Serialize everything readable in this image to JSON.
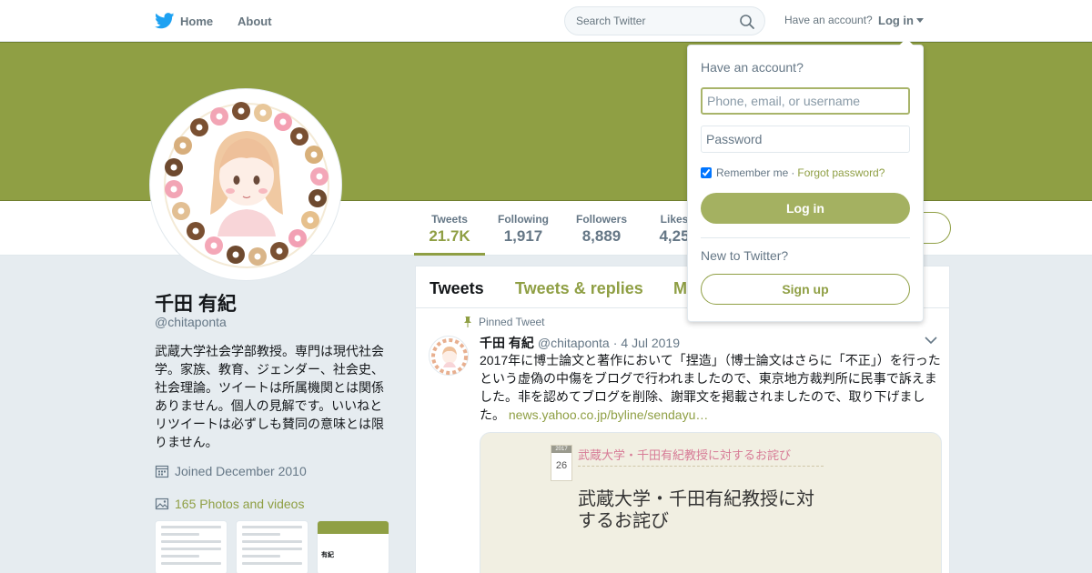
{
  "colors": {
    "accent": "#8f9f44",
    "twitter_blue": "#1da1f2",
    "text_muted": "#657786"
  },
  "nav": {
    "home_label": "Home",
    "about_label": "About",
    "search_placeholder": "Search Twitter",
    "have_account_text": "Have an account?",
    "login_label": "Log in"
  },
  "profile_nav": {
    "stats": [
      {
        "label": "Tweets",
        "value": "21.7K"
      },
      {
        "label": "Following",
        "value": "1,917"
      },
      {
        "label": "Followers",
        "value": "8,889"
      },
      {
        "label": "Likes",
        "value": "4,25"
      }
    ]
  },
  "profile": {
    "name": "千田 有紀",
    "handle": "@chitaponta",
    "bio": "武蔵大学社会学部教授。専門は現代社会学。家族、教育、ジェンダー、社会史、社会理論。ツイートは所属機関とは関係ありません。個人の見解です。いいねとリツイートは必ずしも賛同の意味とは限りません。",
    "joined": "Joined December 2010",
    "photos": "165 Photos and videos",
    "thumb_name": "有紀"
  },
  "timeline": {
    "tabs": [
      "Tweets",
      "Tweets & replies",
      "M"
    ],
    "pinned_label": "Pinned Tweet",
    "tweet": {
      "name": "千田 有紀",
      "handle": "@chitaponta",
      "date": "4 Jul 2019",
      "text": "2017年に博士論文と著作において「捏造」（博士論文はさらに「不正」）を行ったという虚偽の中傷をブログで行われましたので、東京地方裁判所に民事で訴えました。非を認めてブログを削除、謝罪文を掲載されましたので、取り下げました。",
      "link": "news.yahoo.co.jp/byline/sendayu…",
      "card": {
        "cal_month": "2017",
        "cal_day": "26",
        "kicker": "武蔵大学・千田有紀教授に対するお詫び",
        "title": "武蔵大学・千田有紀教授に対するお詫び"
      }
    }
  },
  "login_dropdown": {
    "title": "Have an account?",
    "username_placeholder": "Phone, email, or username",
    "password_placeholder": "Password",
    "remember_label": "Remember me",
    "forgot_label": "Forgot password?",
    "login_button": "Log in",
    "new_label": "New to Twitter?",
    "signup_button": "Sign up"
  }
}
